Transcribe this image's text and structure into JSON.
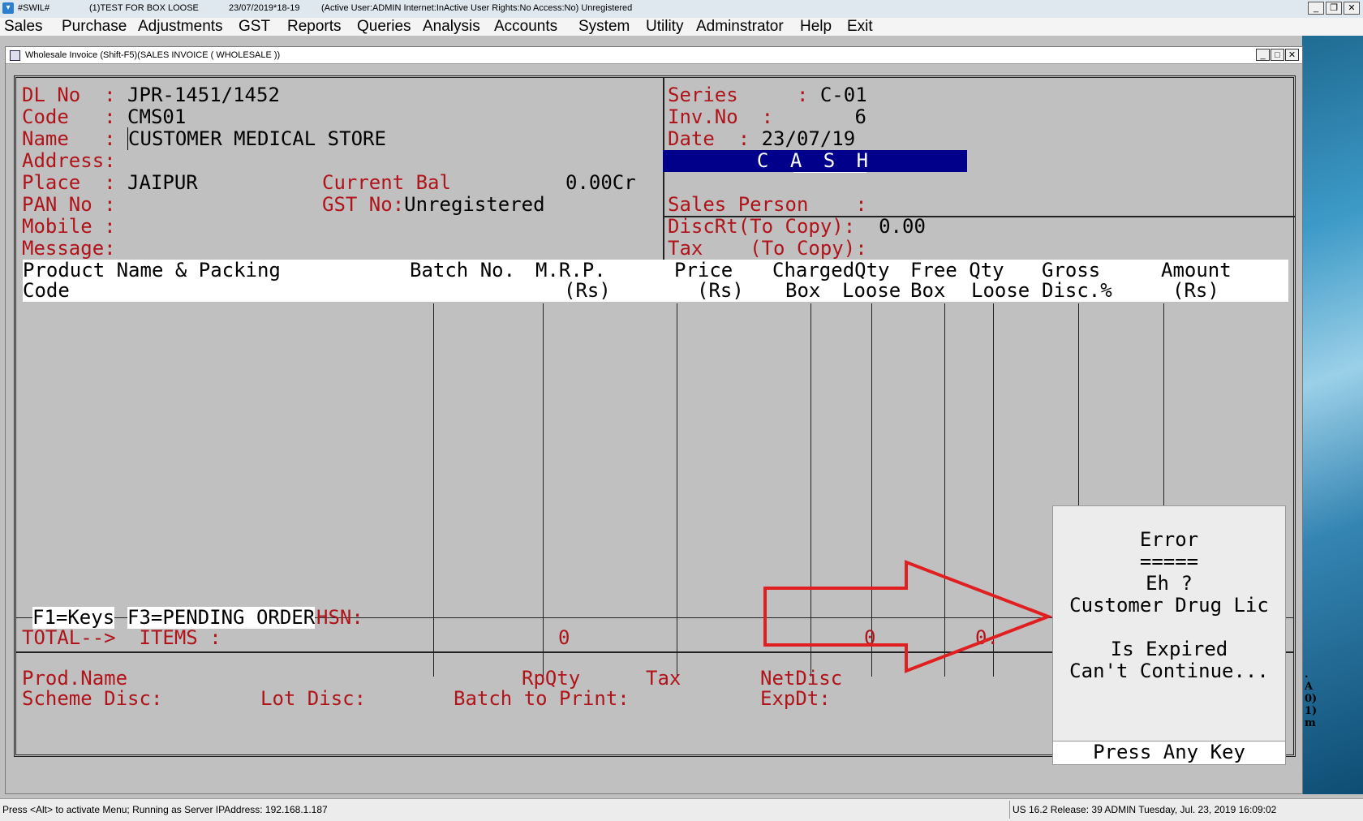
{
  "titlebar": {
    "app": "#SWIL#",
    "company": "(1)TEST FOR BOX LOOSE",
    "date_year": "23/07/2019*18-19",
    "user_info": "(Active User:ADMIN Internet:InActive User Rights:No Access:No) Unregistered",
    "icon": "swil-app-icon"
  },
  "menu": [
    "Sales",
    "Purchase",
    "Adjustments",
    "GST",
    "Reports",
    "Queries",
    "Analysis",
    "Accounts",
    "System",
    "Utility",
    "Adminstrator",
    "Help",
    "Exit"
  ],
  "child_window": {
    "title": "Wholesale Invoice (Shift-F5)(SALES INVOICE ( WHOLESALE ))"
  },
  "header_left": {
    "dl_label": "DL No  :",
    "dl_value": "JPR-1451/1452",
    "code_label": "Code   :",
    "code_value": "CMS01",
    "name_label": "Name   :",
    "name_value": "CUSTOMER MEDICAL STORE",
    "address_label": "Address:",
    "place_label": "Place  :",
    "place_value": "JAIPUR",
    "curbal_label": "Current Bal",
    "curbal_value": "0.00Cr",
    "pan_label": "PAN No :",
    "gst_label": "GST No:",
    "gst_value": "Unregistered",
    "mobile_label": "Mobile :",
    "message_label": "Message:"
  },
  "header_right": {
    "series_label": "Series     :",
    "series_value": "C-01",
    "invno_label": "Inv.No  :",
    "invno_value": "6",
    "date_label": "Date  :",
    "date_value": "23/07/19",
    "mode": "C A S H",
    "salesperson_label": "Sales Person    :",
    "discrt_label": "DiscRt(To Copy):",
    "discrt_value": "0.00",
    "tax_label": "Tax    (To Copy):"
  },
  "columns": {
    "r1": [
      "Product Name & Packing",
      "Batch No.",
      "M.R.P.",
      "Price",
      "ChargedQty",
      "Free Qty",
      "Gross",
      "Amount"
    ],
    "r2": [
      "Code",
      "(Rs)",
      "(Rs)",
      "Box",
      "Loose",
      "Box",
      "Loose",
      "Disc.%",
      "(Rs)"
    ]
  },
  "keys_bar": {
    "f1": "F1=Keys",
    "f3": "F3=PENDING ORDER",
    "hsn": "HSN:"
  },
  "totals": {
    "label": "TOTAL-->  ITEMS :",
    "items": "0",
    "qty": "0",
    "partial": "0."
  },
  "footer": {
    "prod_name": "Prod.Name",
    "rpqty": "RpQty",
    "tax": "Tax",
    "netdisc": "NetDisc",
    "scheme_disc": "Scheme Disc:",
    "lot_disc": "Lot Disc:",
    "batch_to_print": "Batch to Print:",
    "expdt": "ExpDt:"
  },
  "error_dialog": {
    "title": "Error",
    "underline": "=====",
    "line1": "Eh ?",
    "line2": "Customer Drug Lic",
    "line3": "Is Expired",
    "line4": "Can't Continue...",
    "press": "Press Any Key"
  },
  "statusbar": {
    "left": "Press <Alt> to activate Menu; Running as Server IPAddress: 192.168.1.187",
    "right": "US 16.2 Release: 39 ADMIN  Tuesday, Jul. 23, 2019  16:09:02"
  },
  "desktop_fragment": [
    ".",
    "A",
    "0)",
    "1)",
    "m"
  ],
  "colors": {
    "label_red": "#b0141a",
    "cash_bg": "#00008b",
    "arrow_red": "#e02020",
    "screen_bg": "#c0c0c0"
  }
}
